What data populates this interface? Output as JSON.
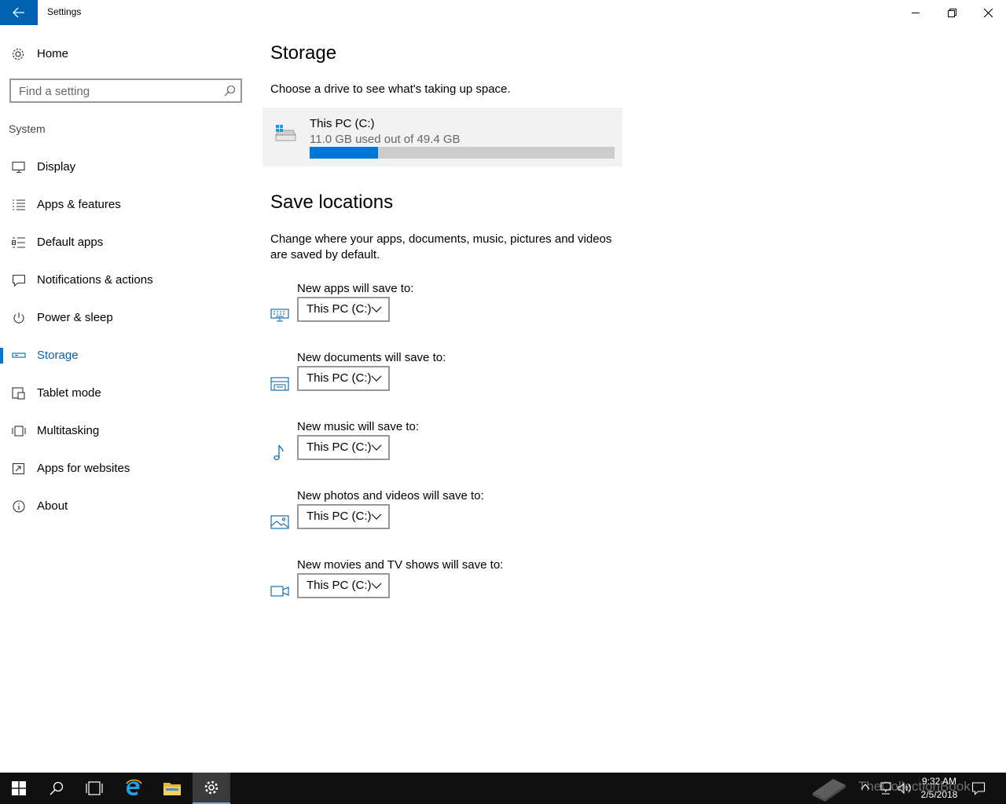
{
  "window": {
    "title": "Settings"
  },
  "sidebar": {
    "home_label": "Home",
    "search_placeholder": "Find a setting",
    "section": "System",
    "items": [
      {
        "label": "Display",
        "icon": "display-icon"
      },
      {
        "label": "Apps & features",
        "icon": "apps-list-icon"
      },
      {
        "label": "Default apps",
        "icon": "default-apps-icon"
      },
      {
        "label": "Notifications & actions",
        "icon": "notifications-icon"
      },
      {
        "label": "Power & sleep",
        "icon": "power-icon"
      },
      {
        "label": "Storage",
        "icon": "storage-icon",
        "active": true
      },
      {
        "label": "Tablet mode",
        "icon": "tablet-mode-icon"
      },
      {
        "label": "Multitasking",
        "icon": "multitasking-icon"
      },
      {
        "label": "Apps for websites",
        "icon": "apps-for-websites-icon"
      },
      {
        "label": "About",
        "icon": "info-icon"
      }
    ]
  },
  "main": {
    "title": "Storage",
    "subtitle": "Choose a drive to see what's taking up space.",
    "drive": {
      "name": "This PC (C:)",
      "usage": "11.0 GB used out of 49.4 GB",
      "used_fraction": 0.223
    },
    "save_locations_title": "Save locations",
    "save_locations_desc": "Change where your apps, documents, music, pictures and videos are saved by default.",
    "locations": [
      {
        "label": "New apps will save to:",
        "value": "This PC (C:)",
        "icon": "apps-keyboard-icon"
      },
      {
        "label": "New documents will save to:",
        "value": "This PC (C:)",
        "icon": "documents-printer-icon"
      },
      {
        "label": "New music will save to:",
        "value": "This PC (C:)",
        "icon": "music-note-icon"
      },
      {
        "label": "New photos and videos will save to:",
        "value": "This PC (C:)",
        "icon": "photos-icon"
      },
      {
        "label": "New movies and TV shows will save to:",
        "value": "This PC (C:)",
        "icon": "video-camera-icon"
      }
    ]
  },
  "taskbar": {
    "time": "9:32 AM",
    "date": "2/5/2018",
    "watermark": "TheCollectionBook"
  },
  "colors": {
    "accent": "#0078d7",
    "accent_dark": "#0063b1",
    "taskbar": "#101010"
  }
}
